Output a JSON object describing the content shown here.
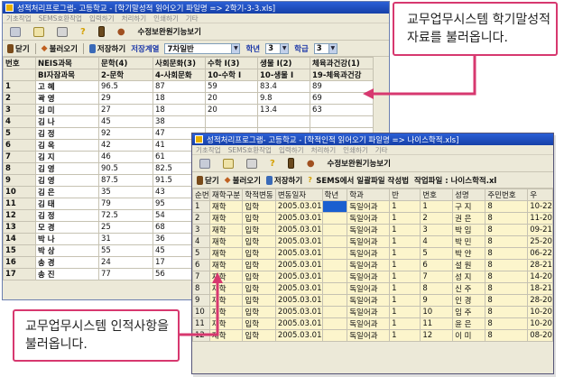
{
  "back_window": {
    "title": "성적처리프로그램- 고등학교 - [학기말성적 읽어오기 파일명 => 2학기-3-3.xls]",
    "menu": [
      "기초작업",
      "SEMS호환작업",
      "입력하기",
      "처리하기",
      "인쇄하기",
      "기타"
    ],
    "iconbar_label": "수정보완원기능보기",
    "actions": {
      "close": "닫기",
      "load": "불러오기",
      "save": "저장하기"
    },
    "filter_label": "저장계열",
    "filter_value": "7차일반",
    "grade_label": "학년",
    "grade_value": "3",
    "class_label": "학급",
    "class_value": "3",
    "header": [
      "번호",
      "NEIS과목",
      "문학(4)",
      "사회문화(3)",
      "수학 I(3)",
      "생물 I(2)",
      "체육과건강(1)"
    ],
    "subheader": [
      "",
      "BI자잠과목",
      "2-문학",
      "4-사회문화",
      "10-수학 I",
      "10-생물 I",
      "19-체육과건강"
    ],
    "rows": [
      [
        "1",
        "고 혜",
        "96.5",
        "87",
        "59",
        "83.4",
        "89"
      ],
      [
        "2",
        "곽 영",
        "29",
        "18",
        "20",
        "9.8",
        "69"
      ],
      [
        "3",
        "김 미",
        "27",
        "18",
        "20",
        "13.4",
        "63"
      ],
      [
        "4",
        "김 나",
        "45",
        "38",
        "",
        "",
        ""
      ],
      [
        "5",
        "김 정",
        "92",
        "47",
        "",
        "",
        ""
      ],
      [
        "6",
        "김 옥",
        "42",
        "41",
        "",
        "",
        ""
      ],
      [
        "7",
        "김 지",
        "46",
        "61",
        "",
        "",
        ""
      ],
      [
        "8",
        "김 영",
        "90.5",
        "82.5",
        "",
        "",
        ""
      ],
      [
        "9",
        "김 영",
        "87.5",
        "91.5",
        "",
        "",
        ""
      ],
      [
        "10",
        "김 은",
        "35",
        "43",
        "",
        "",
        ""
      ],
      [
        "11",
        "김 태",
        "79",
        "95",
        "",
        "",
        ""
      ],
      [
        "12",
        "김 정",
        "72.5",
        "54",
        "",
        "",
        ""
      ],
      [
        "13",
        "모 경",
        "25",
        "68",
        "",
        "",
        ""
      ],
      [
        "14",
        "박 나",
        "31",
        "36",
        "",
        "",
        ""
      ],
      [
        "15",
        "박 상",
        "55",
        "45",
        "",
        "",
        ""
      ],
      [
        "16",
        "송 경",
        "24",
        "17",
        "",
        "",
        ""
      ],
      [
        "17",
        "송 진",
        "77",
        "56",
        "",
        "",
        ""
      ]
    ]
  },
  "front_window": {
    "title": "성적처리프로그램- 고등학교 - [학적인적 읽어오기 파일명 => 나이스학적.xls]",
    "menu": [
      "기초작업",
      "SEMS호환작업",
      "입력하기",
      "처리하기",
      "인쇄하기",
      "기타"
    ],
    "iconbar_label": "수정보완원기능보기",
    "actions": {
      "close": "닫기",
      "load": "불러오기",
      "save": "저장하기"
    },
    "sems_label": "SEMS에서 일괄파일 작성법",
    "work_file": "작업파일 : 나이스학적.xl",
    "header": [
      "순번",
      "재학구분",
      "학적변동",
      "변동일자",
      "학년",
      "학과",
      "반",
      "번호",
      "성명",
      "주민번호",
      "우"
    ],
    "rows": [
      [
        "1",
        "재학",
        "입학",
        "2005.03.01",
        "",
        "독일어과",
        "1",
        "1",
        "구 지",
        "8",
        "10-22"
      ],
      [
        "2",
        "재학",
        "입학",
        "2005.03.01",
        "",
        "독일어과",
        "1",
        "2",
        "권 은",
        "8",
        "11-20"
      ],
      [
        "3",
        "재학",
        "입학",
        "2005.03.01",
        "",
        "독일어과",
        "1",
        "3",
        "박 임",
        "8",
        "09-21"
      ],
      [
        "4",
        "재학",
        "입학",
        "2005.03.01",
        "",
        "독일어과",
        "1",
        "4",
        "박 민",
        "8",
        "25-20"
      ],
      [
        "5",
        "재학",
        "입학",
        "2005.03.01",
        "",
        "독일어과",
        "1",
        "5",
        "박 얀",
        "8",
        "06-22"
      ],
      [
        "6",
        "재학",
        "입학",
        "2005.03.01",
        "",
        "독일어과",
        "1",
        "6",
        "설 원",
        "8",
        "28-21"
      ],
      [
        "7",
        "재학",
        "입학",
        "2005.03.01",
        "",
        "독일어과",
        "1",
        "7",
        "성 지",
        "8",
        "14-20"
      ],
      [
        "8",
        "재학",
        "입학",
        "2005.03.01",
        "",
        "독일어과",
        "1",
        "8",
        "신 주",
        "8",
        "18-21"
      ],
      [
        "9",
        "재학",
        "입학",
        "2005.03.01",
        "",
        "독일어과",
        "1",
        "9",
        "인 경",
        "8",
        "28-20"
      ],
      [
        "10",
        "재학",
        "입학",
        "2005.03.01",
        "",
        "독일어과",
        "1",
        "10",
        "임 주",
        "8",
        "10-20"
      ],
      [
        "11",
        "재학",
        "입학",
        "2005.03.01",
        "",
        "독일어과",
        "1",
        "11",
        "윤 은",
        "8",
        "10-20"
      ],
      [
        "12",
        "재학",
        "입학",
        "2005.03.01",
        "",
        "독일어과",
        "1",
        "12",
        "이 미",
        "8",
        "08-20"
      ]
    ]
  },
  "callouts": {
    "top": [
      "교무업무시스템 학기말성적",
      "자료를 불러옵니다."
    ],
    "bottom": [
      "교무업무시스템 인적사항을",
      "불러옵니다."
    ]
  },
  "colors": {
    "callout_border": "#d7386f",
    "titlebar": "#1f4fc4",
    "selection": "#1a5fd0"
  }
}
